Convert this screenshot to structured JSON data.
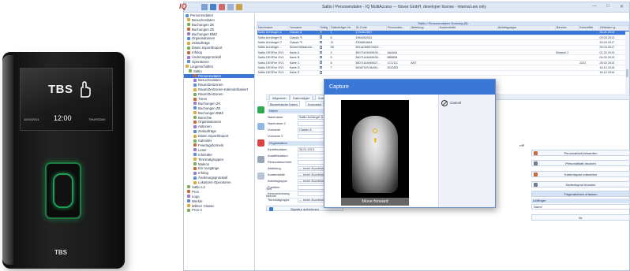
{
  "device": {
    "logo": "TBS",
    "date": "11/04/2011",
    "time": "12:00",
    "day": "THURSDAY",
    "brand": "TBS"
  },
  "app": {
    "logo": "IQ",
    "title": "Saltio / Personendaten - IQ MultiAccess  ---  Novar GmbH, developer license - internal use only",
    "controls": [
      "—",
      "□",
      "✕"
    ]
  },
  "tree": [
    "Personendaten",
    "Besucherdaten",
    "Buchungen ZK",
    "Buchungen ZE",
    "Buchungen BMZ",
    "Organisationen",
    "Zeitaufträge",
    "Daten Import/Export",
    "Infolog",
    "Änderungsprotokoll",
    "Operatoren",
    "Liegenschaften",
    "Saltio",
    "Personendaten",
    "Besucherdaten",
    "Raum/Zeitzonen",
    "Raum/Zeitzonen-Kalenderbasiert",
    "Raum/Zeitzonen",
    "Türen",
    "Buchungen ZK",
    "Buchungen ZE",
    "Buchungen BMZ",
    "Berechte",
    "Organisationen",
    "Aktionen",
    "Zeitaufträge",
    "Daten Import/Export",
    "Kalender",
    "Feiertagsformeln",
    "Leser",
    "Infofelder",
    "Terminalgruppen",
    "Makros",
    "Ein Ausgänge",
    "Infolog",
    "Änderungsprotokoll",
    "Lokations-Operatoren",
    "Saltio L2",
    "Pron",
    "Logo",
    "Werkte",
    "Millenz Classic",
    "Pron-2"
  ],
  "grid": {
    "caption": "Saltio / Personendaten Ordnung (5)",
    "columns": [
      "Nachname",
      "Vorname",
      "Gültig",
      "Datenträger Nr.",
      "ID-Code",
      "Personalnr...",
      "Abteilung",
      "Kostenstelle",
      "Arbeitsgruppe",
      "Bereich",
      "Kennziffer",
      "Geändert g..."
    ],
    "rows": [
      [
        "Saltio Anhänger A",
        "Classic A",
        "",
        "1",
        "1234512867",
        "",
        "",
        "",
        "",
        "",
        "",
        "26.01.2013"
      ],
      [
        "Saltio Anhänger B",
        "Classic ✎",
        "",
        "6",
        "1964052032",
        "",
        "",
        "",
        "",
        "",
        "",
        "09.03.2013"
      ],
      [
        "Saltio Anhänger C",
        "Classic ✎",
        "",
        "11",
        "2306824664",
        "",
        "",
        "",
        "",
        "",
        "",
        "26.04.2017"
      ],
      [
        "Saltio Anhänger ...",
        "Sicherheitsstrom...",
        "",
        "98",
        "36114085674002...",
        "",
        "",
        "",
        "",
        "",
        "",
        "26.04.2017"
      ],
      [
        "Saltio DESFire EV1",
        "Karte A",
        "",
        "4",
        "3607161M49635...",
        "AAAAA",
        "",
        "",
        "",
        "Bereich 2",
        "",
        "01.02.2013"
      ],
      [
        "Saltio DESFire EV1",
        "Karte B",
        "",
        "5",
        "3607161M49635...",
        "BBBBB",
        "",
        "",
        "",
        "",
        "",
        "04.02.2013"
      ],
      [
        "Saltio DESFire EV1",
        "Karte C",
        "",
        "6",
        "3607161M49627...",
        "CCCCC",
        "ANT",
        "",
        "",
        "",
        "2222",
        "28.02.2013"
      ],
      [
        "Saltio DESFire EV1",
        "Karte D",
        "",
        "7",
        "3606702V46494...",
        "DDDDD",
        "",
        "",
        "",
        "",
        "",
        "16.12.2016"
      ],
      [
        "Saltio DESFire EV1",
        "Karte E",
        "",
        "",
        "",
        "",
        "",
        "",
        "",
        "",
        "",
        "16.12.2016"
      ]
    ]
  },
  "tabs": [
    "Allgemein",
    "Datenträger",
    "Zutrittsberechtigungen"
  ],
  "toolbar": {
    "btn1": "Biometrische Daten",
    "btn2": "Kennzahl"
  },
  "form": {
    "section1": "Name",
    "fields1": [
      {
        "label": "Nachname",
        "value": "Saltio Anhänger A"
      },
      {
        "label": "Nachname 2",
        "value": ""
      },
      {
        "label": "Vorname",
        "value": "Classic A"
      },
      {
        "label": "Vorname 2",
        "value": ""
      }
    ],
    "section2": "Organisation",
    "fields2": [
      {
        "label": "Eintrittsdatum",
        "value": "26.01.2013"
      },
      {
        "label": "Austrittsdatum",
        "value": ""
      },
      {
        "label": "Personalnummer",
        "value": ""
      },
      {
        "label": "Abteilung",
        "value": "--- keine Zuordnung ---"
      },
      {
        "label": "Kostenstelle",
        "value": "--- keine Zuordnung ---"
      },
      {
        "label": "Arbeitsgruppe",
        "value": "--- keine Zuordnung ---"
      },
      {
        "label": "Funktion",
        "value": ""
      },
      {
        "label": "Kennzeichnung",
        "value": ""
      },
      {
        "label": "Terminalgruppe",
        "value": "--- keine Zuordnung ---"
      }
    ]
  },
  "right_panel": {
    "btn_a": "Personalblatt entwerfen",
    "btn_b": "Personalblatt drucken",
    "btn_c": "Kartenlayout entwerfen",
    "btn_d": "Kartenlayout drucken",
    "head": "Fingerabdruck erfassen",
    "select_label": "Leitfinger",
    "select_value": "Name",
    "select_value_2": "Nr.",
    "mid_1": "Sen",
    "mid_2": "Nender",
    "sig_btn": "Signatur aufnehmen",
    "extra": "rdR"
  },
  "dialog": {
    "title": "Capture",
    "cancel": "Cancel",
    "message": "Move forward"
  },
  "colors": {
    "accent": "#3b78d6",
    "reader_glow": "#1f9a54",
    "finger_marker": "#e6b100"
  }
}
